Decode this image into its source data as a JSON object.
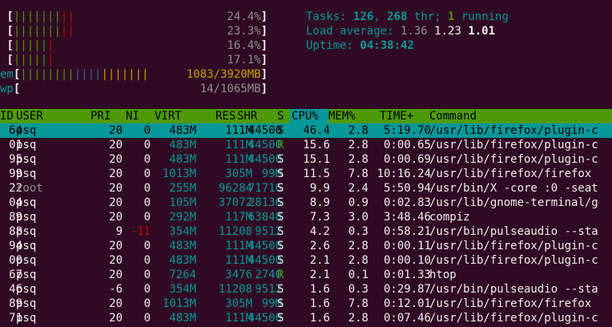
{
  "meters": [
    {
      "label": "",
      "bar": [
        {
          "t": "|||",
          "c": "g"
        },
        {
          "t": "||||",
          "c": "g"
        },
        {
          "t": "||",
          "c": "r"
        }
      ],
      "value": "24.4%",
      "end": "]"
    },
    {
      "label": "",
      "bar": [
        {
          "t": "||||",
          "c": "g"
        },
        {
          "t": "|||",
          "c": "g"
        },
        {
          "t": "||",
          "c": "r"
        }
      ],
      "value": "23.3%",
      "end": "]"
    },
    {
      "label": "",
      "bar": [
        {
          "t": "|||||",
          "c": "g"
        },
        {
          "t": "|",
          "c": "r"
        }
      ],
      "value": "16.4%",
      "end": "]"
    },
    {
      "label": "",
      "bar": [
        {
          "t": "|||||",
          "c": "g"
        },
        {
          "t": "|",
          "c": "r"
        }
      ],
      "value": "17.1%",
      "end": "]"
    },
    {
      "label": "em",
      "bar": [
        {
          "t": "||||||||",
          "c": "g"
        },
        {
          "t": "||||",
          "c": "b"
        },
        {
          "t": "|||||||",
          "c": "y"
        }
      ],
      "value": "1083/3920MB",
      "end": "]"
    },
    {
      "label": "wp",
      "bar": [],
      "value": "14/1065MB",
      "end": "]"
    }
  ],
  "summary": {
    "tasks_label": "Tasks: ",
    "tasks": "126",
    "sep1": ", ",
    "threads": "268",
    "thr_label": " thr; ",
    "running": "1",
    "running_label": " running",
    "load_label": "Load average: ",
    "load1": "1.36",
    "load5": "1.23",
    "load15": "1.01",
    "uptime_label": "Uptime: ",
    "uptime": "04:38:42"
  },
  "columns": [
    "ID",
    "USER",
    "PRI",
    "NI",
    "VIRT",
    "RES",
    "SHR",
    "S",
    "CPU%",
    "MEM%",
    "TIME+",
    "Command"
  ],
  "processes": [
    {
      "pid": "64",
      "user": "psq",
      "pri": "20",
      "ni": "0",
      "virt": "483M",
      "res": "111M",
      "shr": "44500",
      "s": "S",
      "cpu": "46.4",
      "mem": "2.8",
      "time": "5:19.70",
      "cmd": "/usr/lib/firefox/plugin-c"
    },
    {
      "pid": "01",
      "user": "psq",
      "pri": "20",
      "ni": "0",
      "virt": "483M",
      "res": "111M",
      "shr": "44500",
      "s": "R",
      "cpu": "15.6",
      "mem": "2.8",
      "time": "0:00.65",
      "cmd": "/usr/lib/firefox/plugin-c"
    },
    {
      "pid": "95",
      "user": "psq",
      "pri": "20",
      "ni": "0",
      "virt": "483M",
      "res": "111M",
      "shr": "44500",
      "s": "S",
      "cpu": "15.1",
      "mem": "2.8",
      "time": "0:00.69",
      "cmd": "/usr/lib/firefox/plugin-c"
    },
    {
      "pid": "99",
      "user": "psq",
      "pri": "20",
      "ni": "0",
      "virt": "1013M",
      "res": "305M",
      "shr": "99M",
      "s": "S",
      "cpu": "11.5",
      "mem": "7.8",
      "time": "10:16.24",
      "cmd": "/usr/lib/firefox/firefox"
    },
    {
      "pid": "22",
      "user": "root",
      "pri": "20",
      "ni": "0",
      "virt": "255M",
      "res": "96284",
      "shr": "71716",
      "s": "S",
      "cpu": "9.9",
      "mem": "2.4",
      "time": "5:50.94",
      "cmd": "/usr/bin/X -core :0 -seat"
    },
    {
      "pid": "04",
      "user": "psq",
      "pri": "20",
      "ni": "0",
      "virt": "105M",
      "res": "37072",
      "shr": "28136",
      "s": "S",
      "cpu": "8.9",
      "mem": "0.9",
      "time": "0:02.83",
      "cmd": "/usr/lib/gnome-terminal/g"
    },
    {
      "pid": "89",
      "user": "psq",
      "pri": "20",
      "ni": "0",
      "virt": "292M",
      "res": "117M",
      "shr": "63848",
      "s": "S",
      "cpu": "7.3",
      "mem": "3.0",
      "time": "3:48.46",
      "cmd": "compiz"
    },
    {
      "pid": "88",
      "user": "psq",
      "pri": "9",
      "ni": "-11",
      "virt": "354M",
      "res": "11208",
      "shr": "9512",
      "s": "S",
      "cpu": "4.2",
      "mem": "0.3",
      "time": "0:58.21",
      "cmd": "/usr/bin/pulseaudio --sta"
    },
    {
      "pid": "94",
      "user": "psq",
      "pri": "20",
      "ni": "0",
      "virt": "483M",
      "res": "111M",
      "shr": "44500",
      "s": "S",
      "cpu": "2.6",
      "mem": "2.8",
      "time": "0:00.11",
      "cmd": "/usr/lib/firefox/plugin-c"
    },
    {
      "pid": "00",
      "user": "psq",
      "pri": "20",
      "ni": "0",
      "virt": "483M",
      "res": "111M",
      "shr": "44500",
      "s": "S",
      "cpu": "2.1",
      "mem": "2.8",
      "time": "0:00.10",
      "cmd": "/usr/lib/firefox/plugin-c"
    },
    {
      "pid": "67",
      "user": "psq",
      "pri": "20",
      "ni": "0",
      "virt": "7264",
      "res": "3476",
      "shr": "2740",
      "s": "R",
      "cpu": "2.1",
      "mem": "0.1",
      "time": "0:01.33",
      "cmd": "htop"
    },
    {
      "pid": "46",
      "user": "psq",
      "pri": "-6",
      "ni": "0",
      "virt": "354M",
      "res": "11208",
      "shr": "9512",
      "s": "S",
      "cpu": "1.6",
      "mem": "0.3",
      "time": "0:29.87",
      "cmd": "/usr/bin/pulseaudio --sta"
    },
    {
      "pid": "89",
      "user": "psq",
      "pri": "20",
      "ni": "0",
      "virt": "1013M",
      "res": "305M",
      "shr": "99M",
      "s": "S",
      "cpu": "1.6",
      "mem": "7.8",
      "time": "0:12.01",
      "cmd": "/usr/lib/firefox/firefox"
    },
    {
      "pid": "71",
      "user": "psq",
      "pri": "20",
      "ni": "0",
      "virt": "483M",
      "res": "111M",
      "shr": "44500",
      "s": "S",
      "cpu": "1.6",
      "mem": "2.8",
      "time": "0:07.46",
      "cmd": "/usr/lib/firefox/plugin-c"
    }
  ]
}
